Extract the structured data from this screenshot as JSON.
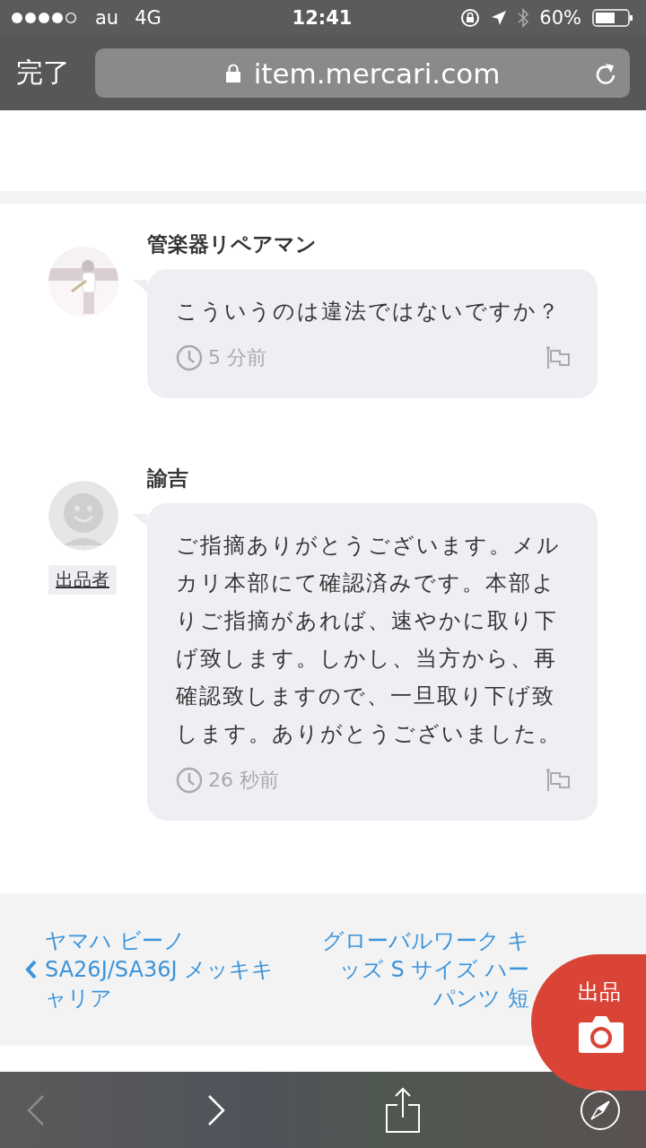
{
  "status_bar": {
    "carrier": "au",
    "network": "4G",
    "time": "12:41",
    "battery": "60%"
  },
  "browser": {
    "done": "完了",
    "url": "item.mercari.com"
  },
  "comments": [
    {
      "name": "管楽器リペアマン",
      "text": "こういうのは違法ではないですか？",
      "time": "5 分前"
    },
    {
      "name": "諭吉",
      "avatar": {
        "kind": "default"
      },
      "badge": "出品者",
      "text": "ご指摘ありがとうございます。メルカリ本部にて確認済みです。本部よりご指摘があれば、速やかに取り下げ致します。しかし、当方から、再確認致しますので、一旦取り下げ致します。ありがとうございました。",
      "time": "26 秒前"
    }
  ],
  "item_nav": {
    "previous": "ヤマハ ビーノ SA26J/SA36J メッキキャリア",
    "next_lines": [
      "グローバルワーク キ",
      "ッズ S サイズ ハー",
      "パンツ 短"
    ]
  },
  "sell_button": "出品",
  "toolbar": {
    "back_disabled": true,
    "forward_disabled": false
  }
}
